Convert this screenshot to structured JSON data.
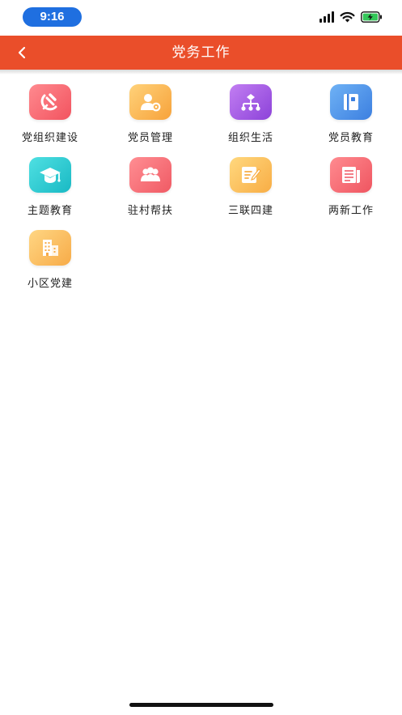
{
  "status_bar": {
    "time": "9:16"
  },
  "header": {
    "title": "党务工作",
    "back_icon": "chevron-left-icon"
  },
  "menu": {
    "items": [
      {
        "id": "party-org",
        "label": "党组织建设",
        "icon": "hammer-sickle-icon",
        "gradient": [
          "#ff8a8f",
          "#f2535f"
        ]
      },
      {
        "id": "member-mgmt",
        "label": "党员管理",
        "icon": "user-settings-icon",
        "gradient": [
          "#ffd27a",
          "#f7a23a"
        ]
      },
      {
        "id": "org-life",
        "label": "组织生活",
        "icon": "org-tree-icon",
        "gradient": [
          "#c27ef2",
          "#8c42d9"
        ]
      },
      {
        "id": "member-edu",
        "label": "党员教育",
        "icon": "notebook-icon",
        "gradient": [
          "#6fb2f5",
          "#3c7fe0"
        ]
      },
      {
        "id": "theme-edu",
        "label": "主题教育",
        "icon": "graduation-cap-icon",
        "gradient": [
          "#4fe0e2",
          "#19b9c4"
        ]
      },
      {
        "id": "village-aid",
        "label": "驻村帮扶",
        "icon": "people-group-icon",
        "gradient": [
          "#ff8e93",
          "#f05a64"
        ]
      },
      {
        "id": "three-four",
        "label": "三联四建",
        "icon": "edit-document-icon",
        "gradient": [
          "#ffd87e",
          "#f8ad45"
        ]
      },
      {
        "id": "two-new",
        "label": "两新工作",
        "icon": "newspaper-icon",
        "gradient": [
          "#ff8b90",
          "#ef5560"
        ]
      },
      {
        "id": "community",
        "label": "小区党建",
        "icon": "buildings-icon",
        "gradient": [
          "#ffd683",
          "#f7ab48"
        ]
      }
    ]
  }
}
